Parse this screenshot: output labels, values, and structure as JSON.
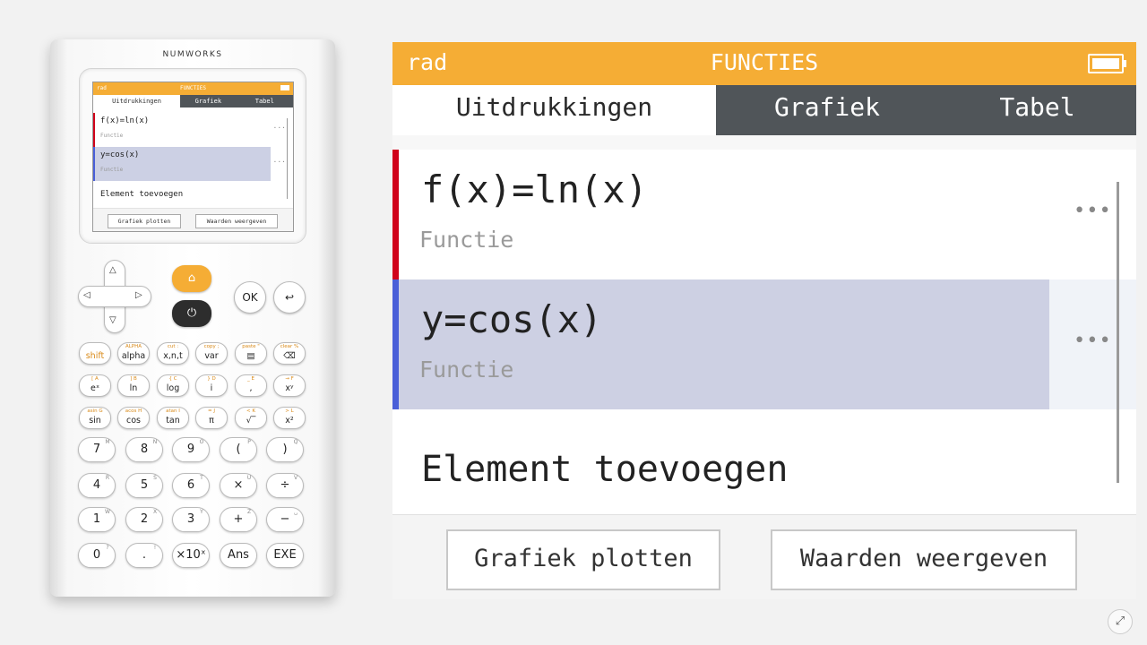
{
  "device": {
    "brand": "NUMWORKS",
    "mini_screen": {
      "mode": "rad",
      "title": "FUNCTIES",
      "tabs": [
        "Uitdrukkingen",
        "Grafiek",
        "Tabel"
      ],
      "functions": [
        {
          "expression": "f(x)=ln(x)",
          "label": "Functie"
        },
        {
          "expression": "y=cos(x)",
          "label": "Functie"
        }
      ],
      "add_label": "Element toevoegen",
      "buttons": [
        "Grafiek plotten",
        "Waarden weergeven"
      ],
      "more": "..."
    },
    "keys": {
      "up": "△",
      "down": "▽",
      "left": "◁",
      "right": "▷",
      "home": "⌂",
      "power": "⏻",
      "ok": "OK",
      "back": "↩",
      "row1": [
        {
          "sup": "",
          "main": "shift"
        },
        {
          "sup": "ALPHA",
          "main": "alpha"
        },
        {
          "sup": "cut :",
          "main": "x,n,t"
        },
        {
          "sup": "copy ;",
          "main": "var"
        },
        {
          "sup": "paste \"",
          "main": "▤"
        },
        {
          "sup": "clear %",
          "main": "⌫"
        }
      ],
      "row2": [
        {
          "sup": "[     A",
          "main": "eˣ"
        },
        {
          "sup": "]     B",
          "main": "ln"
        },
        {
          "sup": "{     C",
          "main": "log"
        },
        {
          "sup": "}     D",
          "main": "i"
        },
        {
          "sup": "_     E",
          "main": ","
        },
        {
          "sup": "→     F",
          "main": "xʸ"
        }
      ],
      "row3": [
        {
          "sup": "asin G",
          "main": "sin"
        },
        {
          "sup": "acos H",
          "main": "cos"
        },
        {
          "sup": "atan I",
          "main": "tan"
        },
        {
          "sup": "=     J",
          "main": "π"
        },
        {
          "sup": "<     K",
          "main": "√‾"
        },
        {
          "sup": ">     L",
          "main": "x²"
        }
      ],
      "row4": [
        {
          "sup": "M",
          "main": "7"
        },
        {
          "sup": "N",
          "main": "8"
        },
        {
          "sup": "O",
          "main": "9"
        },
        {
          "sup": "P",
          "main": "("
        },
        {
          "sup": "Q",
          "main": ")"
        }
      ],
      "row5": [
        {
          "sup": "R",
          "main": "4"
        },
        {
          "sup": "S",
          "main": "5"
        },
        {
          "sup": "T",
          "main": "6"
        },
        {
          "sup": "U",
          "main": "×"
        },
        {
          "sup": "V",
          "main": "÷"
        }
      ],
      "row6": [
        {
          "sup": "W",
          "main": "1"
        },
        {
          "sup": "X",
          "main": "2"
        },
        {
          "sup": "Y",
          "main": "3"
        },
        {
          "sup": "Z",
          "main": "+"
        },
        {
          "sup": "␣",
          "main": "−"
        }
      ],
      "row7": [
        {
          "sup": "?",
          "main": "0"
        },
        {
          "sup": "!",
          "main": "."
        },
        {
          "sup": "",
          "main": "×10ˣ"
        },
        {
          "sup": "",
          "main": "Ans"
        },
        {
          "sup": "",
          "main": "EXE"
        }
      ]
    }
  },
  "screen": {
    "mode": "rad",
    "title": "FUNCTIES",
    "tabs": {
      "expressions": "Uitdrukkingen",
      "graph": "Grafiek",
      "table": "Tabel"
    },
    "functions": [
      {
        "expression": "f(x)=ln(x)",
        "label": "Functie",
        "color": "#d0021b"
      },
      {
        "expression": "y=cos(x)",
        "label": "Functie",
        "color": "#4a5fd8"
      }
    ],
    "more_icon": "•••",
    "add_label": "Element toevoegen",
    "buttons": {
      "plot": "Grafiek plotten",
      "values": "Waarden weergeven"
    }
  },
  "fullscreen_icon": "⤢",
  "colors": {
    "accent": "#f5ad35",
    "tab_dark": "#505559",
    "selected_row": "#cdd0e3"
  }
}
